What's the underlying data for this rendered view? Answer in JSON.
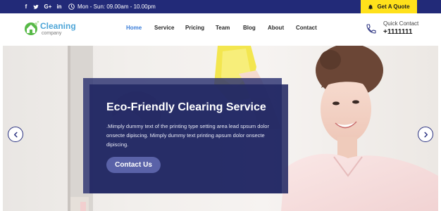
{
  "topbar": {
    "social": [
      {
        "icon": "facebook-icon",
        "glyph": "f"
      },
      {
        "icon": "twitter-icon",
        "glyph": ""
      },
      {
        "icon": "google-plus-icon",
        "glyph": "G+"
      },
      {
        "icon": "linkedin-icon",
        "glyph": "in"
      }
    ],
    "hours": "Mon - Sun: 09.00am - 10.00pm",
    "quote_button": "Get A Quote"
  },
  "header": {
    "logo": {
      "name": "Cleaning",
      "sub": "company"
    },
    "nav": [
      "Home",
      "Service",
      "Pricing",
      "Team",
      "Blog",
      "About",
      "Contact"
    ],
    "active_nav": "Home",
    "quick_contact": {
      "label": "Quick Contact",
      "phone": "+1111111"
    }
  },
  "hero": {
    "title": "Eco-Friendly Clearing Service",
    "text": ".Mimply dummy text of the printing type setting area lead spsum dolor onsecte dipiscing. Mimply dummy text printing apsum dolor onsecte dipiscing.",
    "button": "Contact Us"
  },
  "colors": {
    "topbar": "#222a78",
    "accent_yellow": "#ffe11b",
    "nav_active": "#3d7fd9",
    "overlay": "#222863",
    "button": "#5a62a8"
  }
}
